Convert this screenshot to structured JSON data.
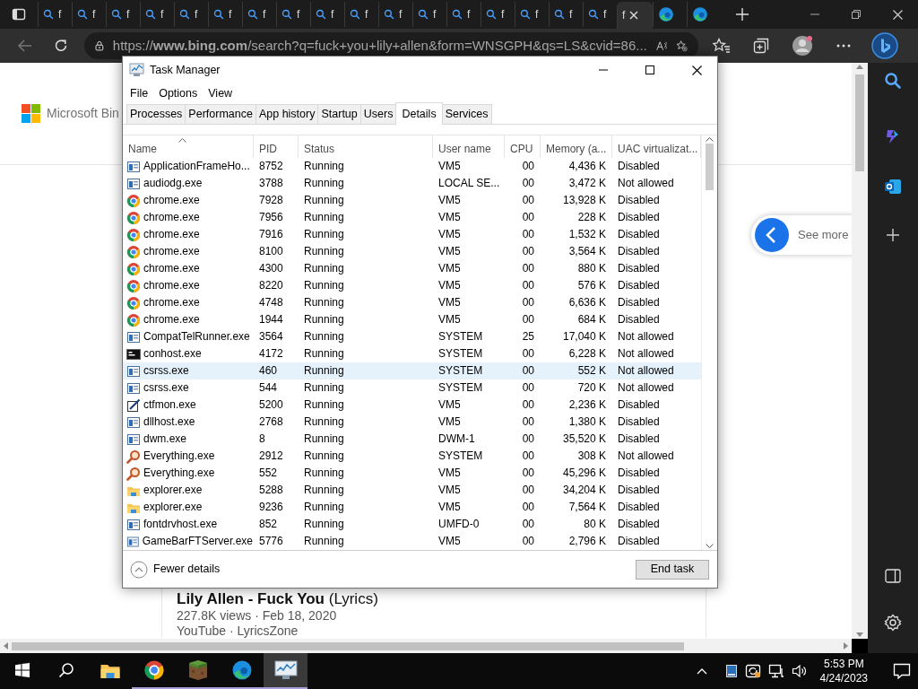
{
  "browser": {
    "tabs": [
      {
        "kind": "search",
        "label": "f",
        "selected": false
      },
      {
        "kind": "search",
        "label": "f",
        "selected": false
      },
      {
        "kind": "search",
        "label": "f",
        "selected": false
      },
      {
        "kind": "search",
        "label": "f",
        "selected": false
      },
      {
        "kind": "search",
        "label": "f",
        "selected": false
      },
      {
        "kind": "search",
        "label": "f",
        "selected": false
      },
      {
        "kind": "search",
        "label": "f",
        "selected": false
      },
      {
        "kind": "search",
        "label": "f",
        "selected": false
      },
      {
        "kind": "search",
        "label": "f",
        "selected": false
      },
      {
        "kind": "search",
        "label": "f",
        "selected": false
      },
      {
        "kind": "search",
        "label": "f",
        "selected": false
      },
      {
        "kind": "search",
        "label": "f",
        "selected": false
      },
      {
        "kind": "search",
        "label": "f",
        "selected": false
      },
      {
        "kind": "search",
        "label": "f",
        "selected": false
      },
      {
        "kind": "search",
        "label": "f",
        "selected": false
      },
      {
        "kind": "search",
        "label": "f",
        "selected": false
      },
      {
        "kind": "search",
        "label": "f",
        "selected": false
      },
      {
        "kind": "page",
        "label": "f",
        "selected": true
      },
      {
        "kind": "edge",
        "selected": false
      },
      {
        "kind": "edge",
        "selected": false
      }
    ],
    "url": "https://**www.bing.com**/search?q=fuck+you+lily+allen&form=WNSGPH&qs=LS&cvid=86..."
  },
  "page": {
    "logo": "Microsoft Bin",
    "see_more": "See more",
    "result": {
      "title": "**Lily Allen - Fuck You** (Lyrics)",
      "meta": "227.8K views · Feb 18, 2020",
      "source": "YouTube · LyricsZone"
    }
  },
  "task_manager": {
    "title": "Task Manager",
    "menu": [
      "File",
      "Options",
      "View"
    ],
    "tabs": [
      {
        "label": "Processes",
        "selected": false
      },
      {
        "label": "Performance",
        "selected": false
      },
      {
        "label": "App history",
        "selected": false
      },
      {
        "label": "Startup",
        "selected": false
      },
      {
        "label": "Users",
        "selected": false
      },
      {
        "label": "Details",
        "selected": true
      },
      {
        "label": "Services",
        "selected": false
      }
    ],
    "columns": [
      "Name",
      "PID",
      "Status",
      "User name",
      "CPU",
      "Memory (a...",
      "UAC virtualizat..."
    ],
    "rows": [
      {
        "kind": "app",
        "cells": [
          "ApplicationFrameHo...",
          "8752",
          "Running",
          "VM5",
          "00",
          "4,436 K",
          "Disabled"
        ],
        "highlighted": false
      },
      {
        "kind": "app",
        "cells": [
          "audiodg.exe",
          "3788",
          "Running",
          "LOCAL SE...",
          "00",
          "3,472 K",
          "Not allowed"
        ],
        "highlighted": false
      },
      {
        "kind": "chrome",
        "cells": [
          "chrome.exe",
          "7928",
          "Running",
          "VM5",
          "00",
          "13,928 K",
          "Disabled"
        ],
        "highlighted": false
      },
      {
        "kind": "chrome",
        "cells": [
          "chrome.exe",
          "7956",
          "Running",
          "VM5",
          "00",
          "228 K",
          "Disabled"
        ],
        "highlighted": false
      },
      {
        "kind": "chrome",
        "cells": [
          "chrome.exe",
          "7916",
          "Running",
          "VM5",
          "00",
          "1,532 K",
          "Disabled"
        ],
        "highlighted": false
      },
      {
        "kind": "chrome",
        "cells": [
          "chrome.exe",
          "8100",
          "Running",
          "VM5",
          "00",
          "3,564 K",
          "Disabled"
        ],
        "highlighted": false
      },
      {
        "kind": "chrome",
        "cells": [
          "chrome.exe",
          "4300",
          "Running",
          "VM5",
          "00",
          "880 K",
          "Disabled"
        ],
        "highlighted": false
      },
      {
        "kind": "chrome",
        "cells": [
          "chrome.exe",
          "8220",
          "Running",
          "VM5",
          "00",
          "576 K",
          "Disabled"
        ],
        "highlighted": false
      },
      {
        "kind": "chrome",
        "cells": [
          "chrome.exe",
          "4748",
          "Running",
          "VM5",
          "00",
          "6,636 K",
          "Disabled"
        ],
        "highlighted": false
      },
      {
        "kind": "chrome",
        "cells": [
          "chrome.exe",
          "1944",
          "Running",
          "VM5",
          "00",
          "684 K",
          "Disabled"
        ],
        "highlighted": false
      },
      {
        "kind": "app",
        "cells": [
          "CompatTelRunner.exe",
          "3564",
          "Running",
          "SYSTEM",
          "25",
          "17,040 K",
          "Not allowed"
        ],
        "highlighted": false
      },
      {
        "kind": "console",
        "cells": [
          "conhost.exe",
          "4172",
          "Running",
          "SYSTEM",
          "00",
          "6,228 K",
          "Not allowed"
        ],
        "highlighted": false
      },
      {
        "kind": "app",
        "cells": [
          "csrss.exe",
          "460",
          "Running",
          "SYSTEM",
          "00",
          "552 K",
          "Not allowed"
        ],
        "highlighted": true
      },
      {
        "kind": "app",
        "cells": [
          "csrss.exe",
          "544",
          "Running",
          "SYSTEM",
          "00",
          "720 K",
          "Not allowed"
        ],
        "highlighted": false
      },
      {
        "kind": "pen",
        "cells": [
          "ctfmon.exe",
          "5200",
          "Running",
          "VM5",
          "00",
          "2,236 K",
          "Disabled"
        ],
        "highlighted": false
      },
      {
        "kind": "app",
        "cells": [
          "dllhost.exe",
          "2768",
          "Running",
          "VM5",
          "00",
          "1,380 K",
          "Disabled"
        ],
        "highlighted": false
      },
      {
        "kind": "app",
        "cells": [
          "dwm.exe",
          "8",
          "Running",
          "DWM-1",
          "00",
          "35,520 K",
          "Disabled"
        ],
        "highlighted": false
      },
      {
        "kind": "magnifier",
        "cells": [
          "Everything.exe",
          "2912",
          "Running",
          "SYSTEM",
          "00",
          "308 K",
          "Not allowed"
        ],
        "highlighted": false
      },
      {
        "kind": "magnifier",
        "cells": [
          "Everything.exe",
          "552",
          "Running",
          "VM5",
          "00",
          "45,296 K",
          "Disabled"
        ],
        "highlighted": false
      },
      {
        "kind": "folder",
        "cells": [
          "explorer.exe",
          "5288",
          "Running",
          "VM5",
          "00",
          "34,204 K",
          "Disabled"
        ],
        "highlighted": false
      },
      {
        "kind": "folder",
        "cells": [
          "explorer.exe",
          "9236",
          "Running",
          "VM5",
          "00",
          "7,564 K",
          "Disabled"
        ],
        "highlighted": false
      },
      {
        "kind": "app",
        "cells": [
          "fontdrvhost.exe",
          "852",
          "Running",
          "UMFD-0",
          "00",
          "80 K",
          "Disabled"
        ],
        "highlighted": false
      },
      {
        "kind": "app",
        "cells": [
          "GameBarFTServer.exe",
          "5776",
          "Running",
          "VM5",
          "00",
          "2,796 K",
          "Disabled"
        ],
        "highlighted": false
      }
    ],
    "fewer_details": "Fewer details",
    "end_task": "End task"
  },
  "taskbar": {
    "apps": [
      {
        "kind": "folder",
        "running": false,
        "active": false
      },
      {
        "kind": "chrome",
        "running": true,
        "active": false
      },
      {
        "kind": "block",
        "running": true,
        "active": false
      },
      {
        "kind": "edge",
        "running": true,
        "active": false
      },
      {
        "kind": "taskmgr",
        "running": true,
        "active": true
      }
    ],
    "time": "5:53 PM",
    "date": "4/24/2023"
  }
}
